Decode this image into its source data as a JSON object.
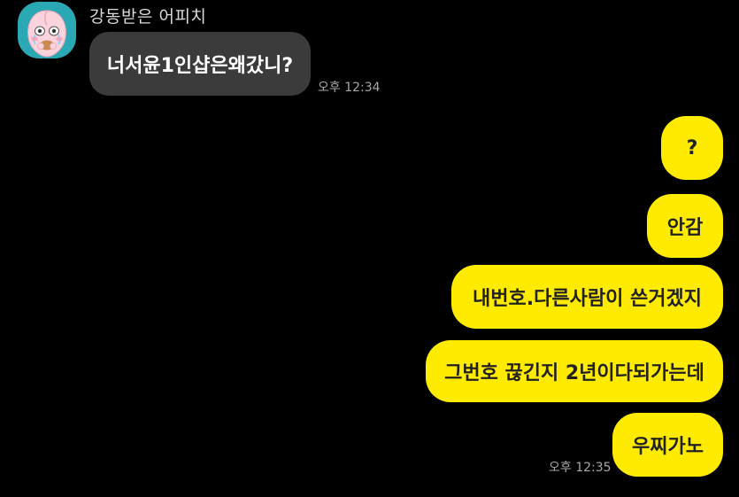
{
  "sender": {
    "name": "강동받은 어피치",
    "avatar_icon": "apeach-crying-icon"
  },
  "received": [
    {
      "text": "너서윤1인샵은왜갔니?",
      "time": "오후 12:34"
    }
  ],
  "sent": [
    {
      "text": "?"
    },
    {
      "text": "안감"
    },
    {
      "text": "내번호.다른사람이 쓴거겠지"
    },
    {
      "text": "그번호 끊긴지 2년이다되가는데"
    },
    {
      "text": "우찌가노",
      "time": "오후 12:35"
    }
  ],
  "colors": {
    "background": "#000000",
    "received_bubble": "#3b3b3b",
    "sent_bubble": "#ffeb00",
    "avatar_bg": "#2aa9b4"
  }
}
